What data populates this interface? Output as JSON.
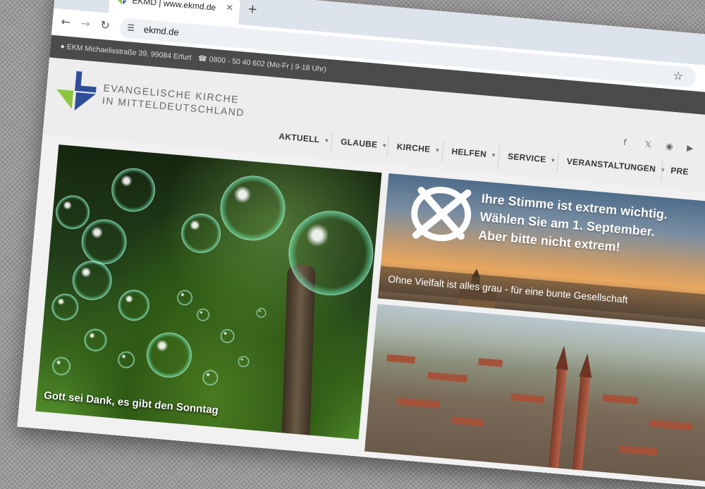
{
  "browser": {
    "tab_title": "EKMD | www.ekmd.de",
    "url": "ekmd.de",
    "new_tab": "+",
    "close": "×"
  },
  "site": {
    "topbar": {
      "address": "EKM Michaelisstraße 39, 99084 Erfurt",
      "phone": "0800 - 50 40 602  (Mo-Fr | 9-18 Uhr)"
    },
    "logo": {
      "line1": "EVANGELISCHE KIRCHE",
      "line2": "IN MITTELDEUTSCHLAND"
    },
    "nav": [
      "AKTUELL",
      "GLAUBE",
      "KIRCHE",
      "HELFEN",
      "SERVICE",
      "VERANSTALTUNGEN",
      "PRE"
    ],
    "hero_caption": "Gott sei Dank, es gibt den Sonntag",
    "banner": {
      "line1": "Ihre Stimme ist extrem wichtig.",
      "line2": "Wählen Sie am 1. September.",
      "line3": "Aber bitte nicht extrem!",
      "subtitle": "Ohne Vielfalt ist alles grau - für eine bunte Gesellschaft"
    }
  },
  "colors": {
    "brand_blue": "#2e4e9a",
    "brand_green": "#8cc63f",
    "topbar": "#4b4b4b"
  }
}
